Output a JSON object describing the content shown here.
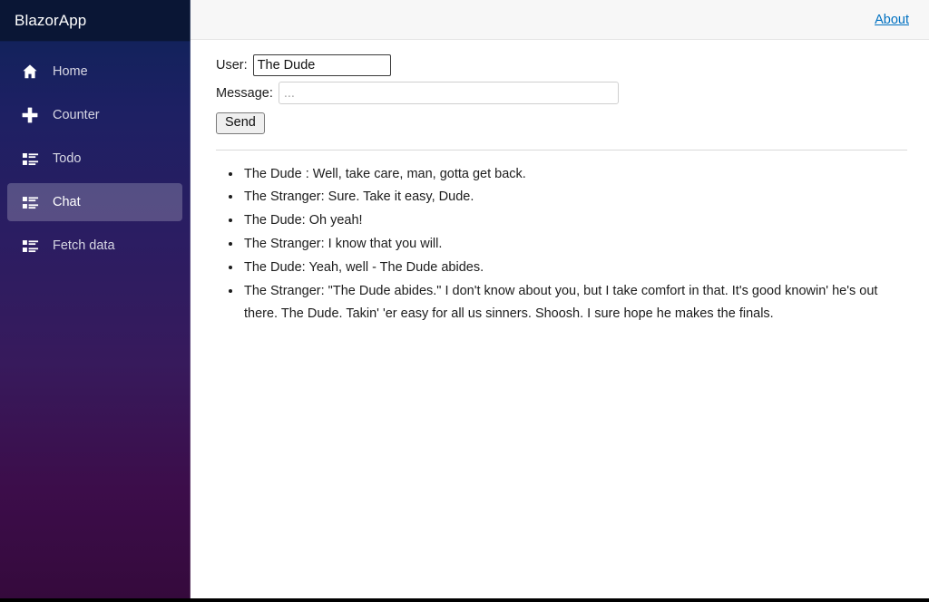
{
  "app": {
    "brand": "BlazorApp"
  },
  "sidebar": {
    "items": [
      {
        "label": "Home",
        "icon": "home-icon",
        "active": false
      },
      {
        "label": "Counter",
        "icon": "plus-icon",
        "active": false
      },
      {
        "label": "Todo",
        "icon": "list-rich-icon",
        "active": false
      },
      {
        "label": "Chat",
        "icon": "list-rich-icon",
        "active": true
      },
      {
        "label": "Fetch data",
        "icon": "list-rich-icon",
        "active": false
      }
    ]
  },
  "header": {
    "about_label": "About"
  },
  "form": {
    "user_label": "User:",
    "user_value": "The Dude",
    "user_placeholder": "",
    "message_label": "Message:",
    "message_value": "",
    "message_placeholder": "...",
    "send_label": "Send"
  },
  "chat": {
    "messages": [
      "The Dude : Well, take care, man, gotta get back.",
      "The Stranger: Sure. Take it easy, Dude.",
      "The Dude: Oh yeah!",
      "The Stranger: I know that you will.",
      "The Dude: Yeah, well - The Dude abides.",
      "The Stranger: \"The Dude abides.\" I don't know about you, but I take comfort in that. It's good knowin' he's out there. The Dude. Takin' 'er easy for all us sinners. Shoosh. I sure hope he makes the finals."
    ]
  },
  "colors": {
    "sidebar_top": "#0a1a41",
    "sidebar_bottom": "#350a3c",
    "brand_bar": "#0a1635",
    "active_item": "rgba(255,255,255,0.22)",
    "link": "#0071c1",
    "topbar_bg": "#f7f7f7"
  }
}
